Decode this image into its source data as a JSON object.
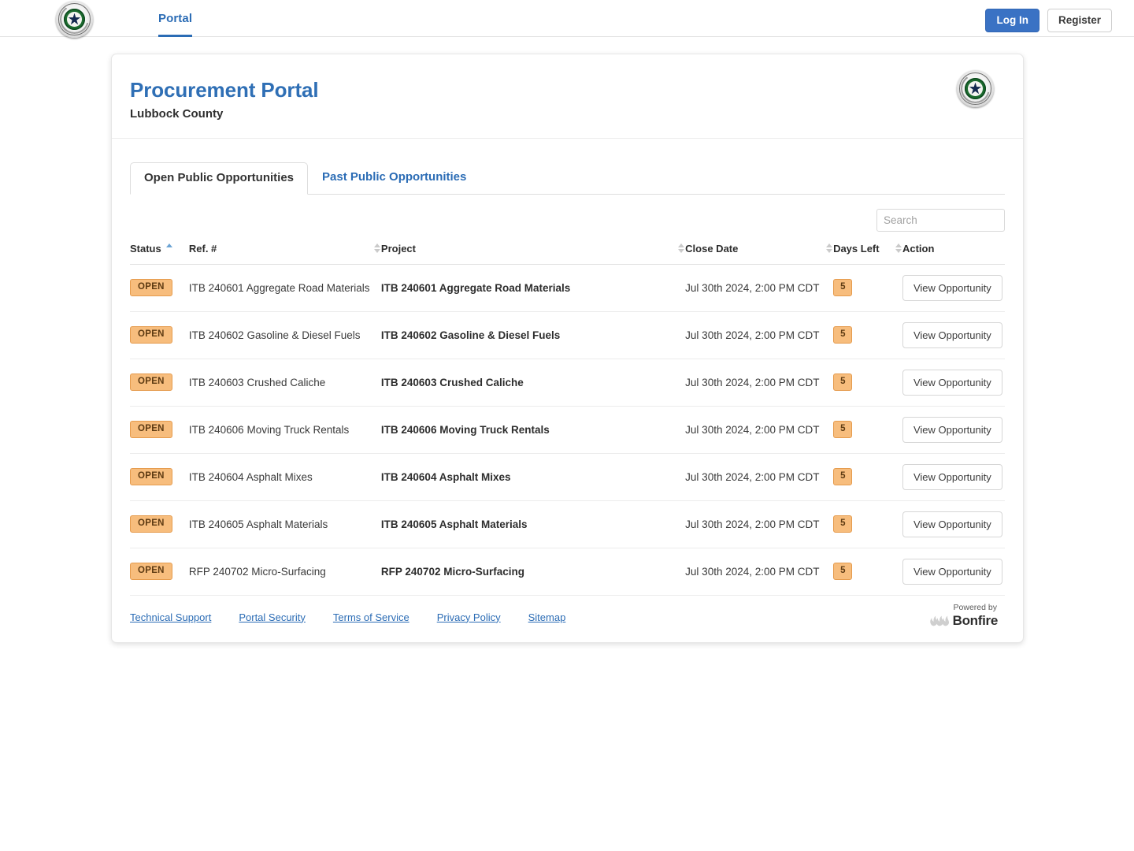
{
  "navbar": {
    "logo_alt": "Lubbock County seal",
    "tab_label": "Portal",
    "login_label": "Log In",
    "register_label": "Register"
  },
  "header": {
    "title": "Procurement Portal",
    "subtitle": "Lubbock County",
    "seal_alt": "Lubbock County seal"
  },
  "tabs": [
    {
      "label": "Open Public Opportunities",
      "active": true
    },
    {
      "label": "Past Public Opportunities",
      "active": false
    }
  ],
  "search": {
    "placeholder": "Search",
    "value": ""
  },
  "table": {
    "columns": [
      {
        "label": "Status",
        "sort": "asc"
      },
      {
        "label": "Ref. #",
        "sort": "none"
      },
      {
        "label": "Project",
        "sort": "none"
      },
      {
        "label": "Close Date",
        "sort": "none"
      },
      {
        "label": "Days Left",
        "sort": "none"
      },
      {
        "label": "Action",
        "sort": "none"
      }
    ],
    "action_label": "View Opportunity",
    "rows": [
      {
        "status": "OPEN",
        "ref": "ITB 240601 Aggregate Road Materials",
        "project": "ITB 240601 Aggregate Road Materials",
        "close_date": "Jul 30th 2024, 2:00 PM CDT",
        "days_left": "5"
      },
      {
        "status": "OPEN",
        "ref": "ITB 240602 Gasoline & Diesel Fuels",
        "project": "ITB 240602 Gasoline & Diesel Fuels",
        "close_date": "Jul 30th 2024, 2:00 PM CDT",
        "days_left": "5"
      },
      {
        "status": "OPEN",
        "ref": "ITB 240603 Crushed Caliche",
        "project": "ITB 240603 Crushed Caliche",
        "close_date": "Jul 30th 2024, 2:00 PM CDT",
        "days_left": "5"
      },
      {
        "status": "OPEN",
        "ref": "ITB 240606 Moving Truck Rentals",
        "project": "ITB 240606 Moving Truck Rentals",
        "close_date": "Jul 30th 2024, 2:00 PM CDT",
        "days_left": "5"
      },
      {
        "status": "OPEN",
        "ref": "ITB 240604 Asphalt Mixes",
        "project": "ITB 240604 Asphalt Mixes",
        "close_date": "Jul 30th 2024, 2:00 PM CDT",
        "days_left": "5"
      },
      {
        "status": "OPEN",
        "ref": "ITB 240605 Asphalt Materials",
        "project": "ITB 240605 Asphalt Materials",
        "close_date": "Jul 30th 2024, 2:00 PM CDT",
        "days_left": "5"
      },
      {
        "status": "OPEN",
        "ref": "RFP 240702 Micro-Surfacing",
        "project": "RFP 240702 Micro-Surfacing",
        "close_date": "Jul 30th 2024, 2:00 PM CDT",
        "days_left": "5"
      }
    ]
  },
  "footer": {
    "links": [
      "Technical Support",
      "Portal Security",
      "Terms of Service",
      "Privacy Policy",
      "Sitemap"
    ],
    "powered_by_label": "Powered by",
    "powered_by_brand": "Bonfire"
  },
  "colors": {
    "accent_blue": "#2b6cb5",
    "login_button": "#3a72c4",
    "badge_orange": "#f7bd7d",
    "badge_orange_border": "#e59b4d",
    "badge_text": "#5d3a12",
    "seal_green": "#1c6b2f",
    "seal_star": "#13284f"
  }
}
